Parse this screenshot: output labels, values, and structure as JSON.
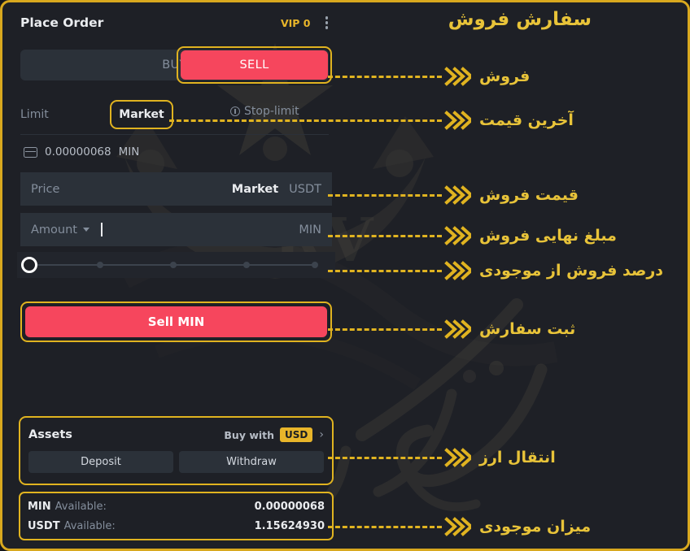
{
  "window": {
    "frame_color": "#d8a81e",
    "background": "#1e2026"
  },
  "header": {
    "title": "Place Order",
    "vip_badge": "VIP 0",
    "kebab_icon": "more-vertical-icon"
  },
  "side_toggle": {
    "buy_label": "BUY",
    "sell_label": "SELL",
    "active": "SELL",
    "sell_color": "#f6465d"
  },
  "order_type": {
    "limit_label": "Limit",
    "market_label": "Market",
    "stop_limit_label": "Stop-limit",
    "active": "Market"
  },
  "wallet": {
    "icon": "wallet-icon",
    "amount": "0.00000068",
    "currency": "MIN"
  },
  "price_field": {
    "placeholder": "Price",
    "value": "",
    "mode_label": "Market",
    "unit": "USDT"
  },
  "amount_field": {
    "placeholder": "Amount",
    "value": "",
    "unit": "MIN",
    "caret_icon": "chevron-down-icon"
  },
  "slider": {
    "percent": 0,
    "ticks": [
      0,
      25,
      50,
      75,
      100
    ]
  },
  "submit": {
    "label": "Sell MIN",
    "color": "#f6465d"
  },
  "assets": {
    "title": "Assets",
    "buy_with_label": "Buy with",
    "currency_badge": "USD",
    "chevron_icon": "chevron-right-icon",
    "deposit_label": "Deposit",
    "withdraw_label": "Withdraw"
  },
  "balances": [
    {
      "symbol": "MIN",
      "label": "Available:",
      "value": "0.00000068"
    },
    {
      "symbol": "USDT",
      "label": "Available:",
      "value": "1.15624930"
    }
  ],
  "annotations": {
    "title": "سفارش فروش",
    "items": [
      {
        "label": "فروش"
      },
      {
        "label": "آخرین قیمت"
      },
      {
        "label": "قیمت فروش"
      },
      {
        "label": "مبلغ نهایی فروش"
      },
      {
        "label": "درصد فروش از موجودی"
      },
      {
        "label": "ثبت سفارش"
      },
      {
        "label": "انتقال ارز"
      },
      {
        "label": "میزان موجودی"
      }
    ],
    "accent_color": "#e8c339",
    "arrow_icon": "triple-chevron-right-icon"
  }
}
